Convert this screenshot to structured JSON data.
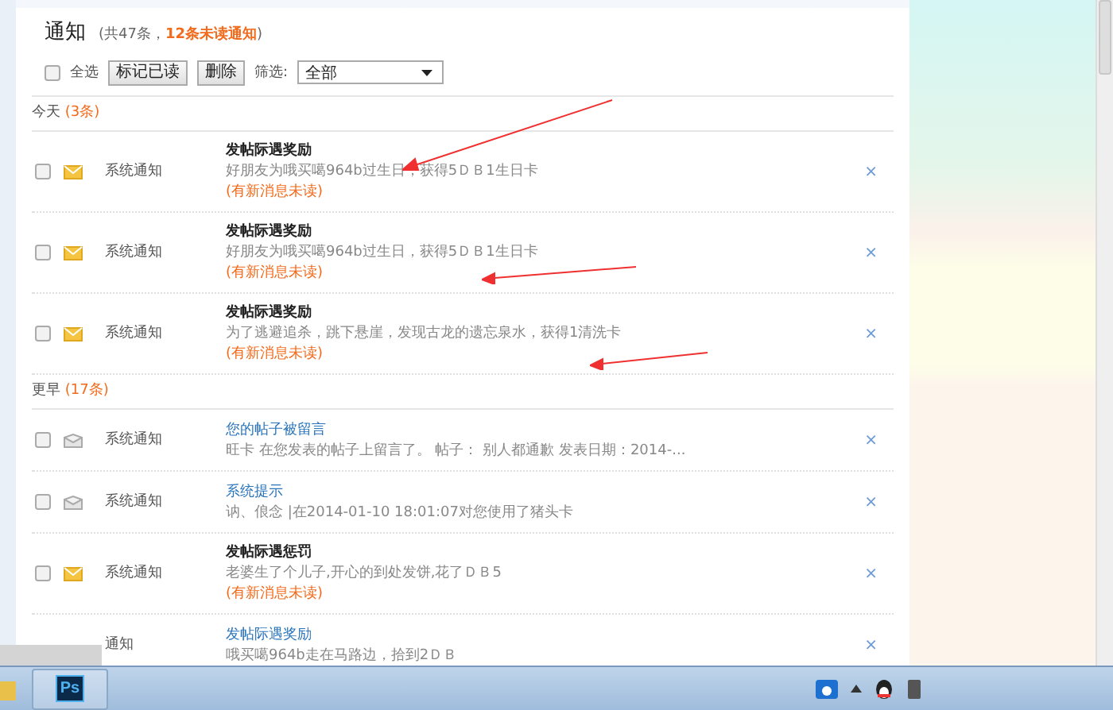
{
  "header": {
    "title": "通知",
    "count_prefix": "(共47条，",
    "unread_count": "12条未读通知",
    "count_suffix": ")"
  },
  "toolbar": {
    "select_all": {
      "label": "全选",
      "checked": false
    },
    "buttons": [
      "标记已读",
      "删除"
    ],
    "filter": {
      "label": "筛选:",
      "value": "全部"
    }
  },
  "groups": [
    {
      "label": "今天",
      "count": "(3条)",
      "items": [
        {
          "checked": false,
          "unread": true,
          "source": "系统通知",
          "title": "发帖际遇奖励",
          "body": "好朋友为哦买噶964b过生日，获得5ＤＢ1生日卡",
          "note": "(有新消息未读)",
          "close": "×"
        },
        {
          "checked": false,
          "unread": true,
          "source": "系统通知",
          "title": "发帖际遇奖励",
          "body": "好朋友为哦买噶964b过生日，获得5ＤＢ1生日卡",
          "note": "(有新消息未读)",
          "close": "×"
        },
        {
          "checked": false,
          "unread": true,
          "source": "系统通知",
          "title": "发帖际遇奖励",
          "body": "为了逃避追杀，跳下悬崖，发现古龙的遗忘泉水，获得1清洗卡",
          "note": "(有新消息未读)",
          "close": "×"
        }
      ]
    },
    {
      "label": "更早",
      "count": "(17条)",
      "items": [
        {
          "checked": false,
          "unread": false,
          "source": "系统通知",
          "title": "您的帖子被留言",
          "body": "旺卡 在您发表的帖子上留言了。 帖子： 别人都通歉 发表日期：2014-...",
          "close": "×"
        },
        {
          "checked": false,
          "unread": false,
          "source": "系统通知",
          "title": "系统提示",
          "body": "讷、俍念 |在2014-01-10 18:01:07对您使用了猪头卡",
          "close": "×"
        },
        {
          "checked": false,
          "unread": true,
          "source": "系统通知",
          "title": "发帖际遇惩罚",
          "body": "老婆生了个儿子,开心的到处发饼,花了ＤＢ5",
          "note": "(有新消息未读)",
          "close": "×"
        },
        {
          "unread": false,
          "source": "通知",
          "title": "发帖际遇奖励",
          "body": "哦买噶964b走在马路边，拾到2ＤＢ",
          "close": "×"
        }
      ]
    }
  ],
  "taskbar": {
    "apps": [
      "Ps"
    ]
  }
}
